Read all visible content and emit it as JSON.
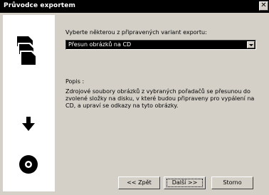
{
  "window": {
    "title": "Průvodce exportem",
    "close_glyph": "✕"
  },
  "sidebar": {
    "icons": [
      "document-stack-icon",
      "down-arrow-icon",
      "cd-disc-icon"
    ]
  },
  "main": {
    "choose_label": "Vyberte některou z připravených variant exportu:",
    "export_variant": {
      "selected": "Přesun obrázků na CD"
    },
    "description_label": "Popis :",
    "description_text": "Zdrojové soubory obrázků z vybraných pořadačů se přesunou do zvolené složky na disku, v které budou připraveny pro vypálení na CD, a upraví se odkazy na tyto obrázky."
  },
  "buttons": {
    "back": "<< Zpět",
    "next": "Další >>",
    "cancel": "Storno"
  }
}
